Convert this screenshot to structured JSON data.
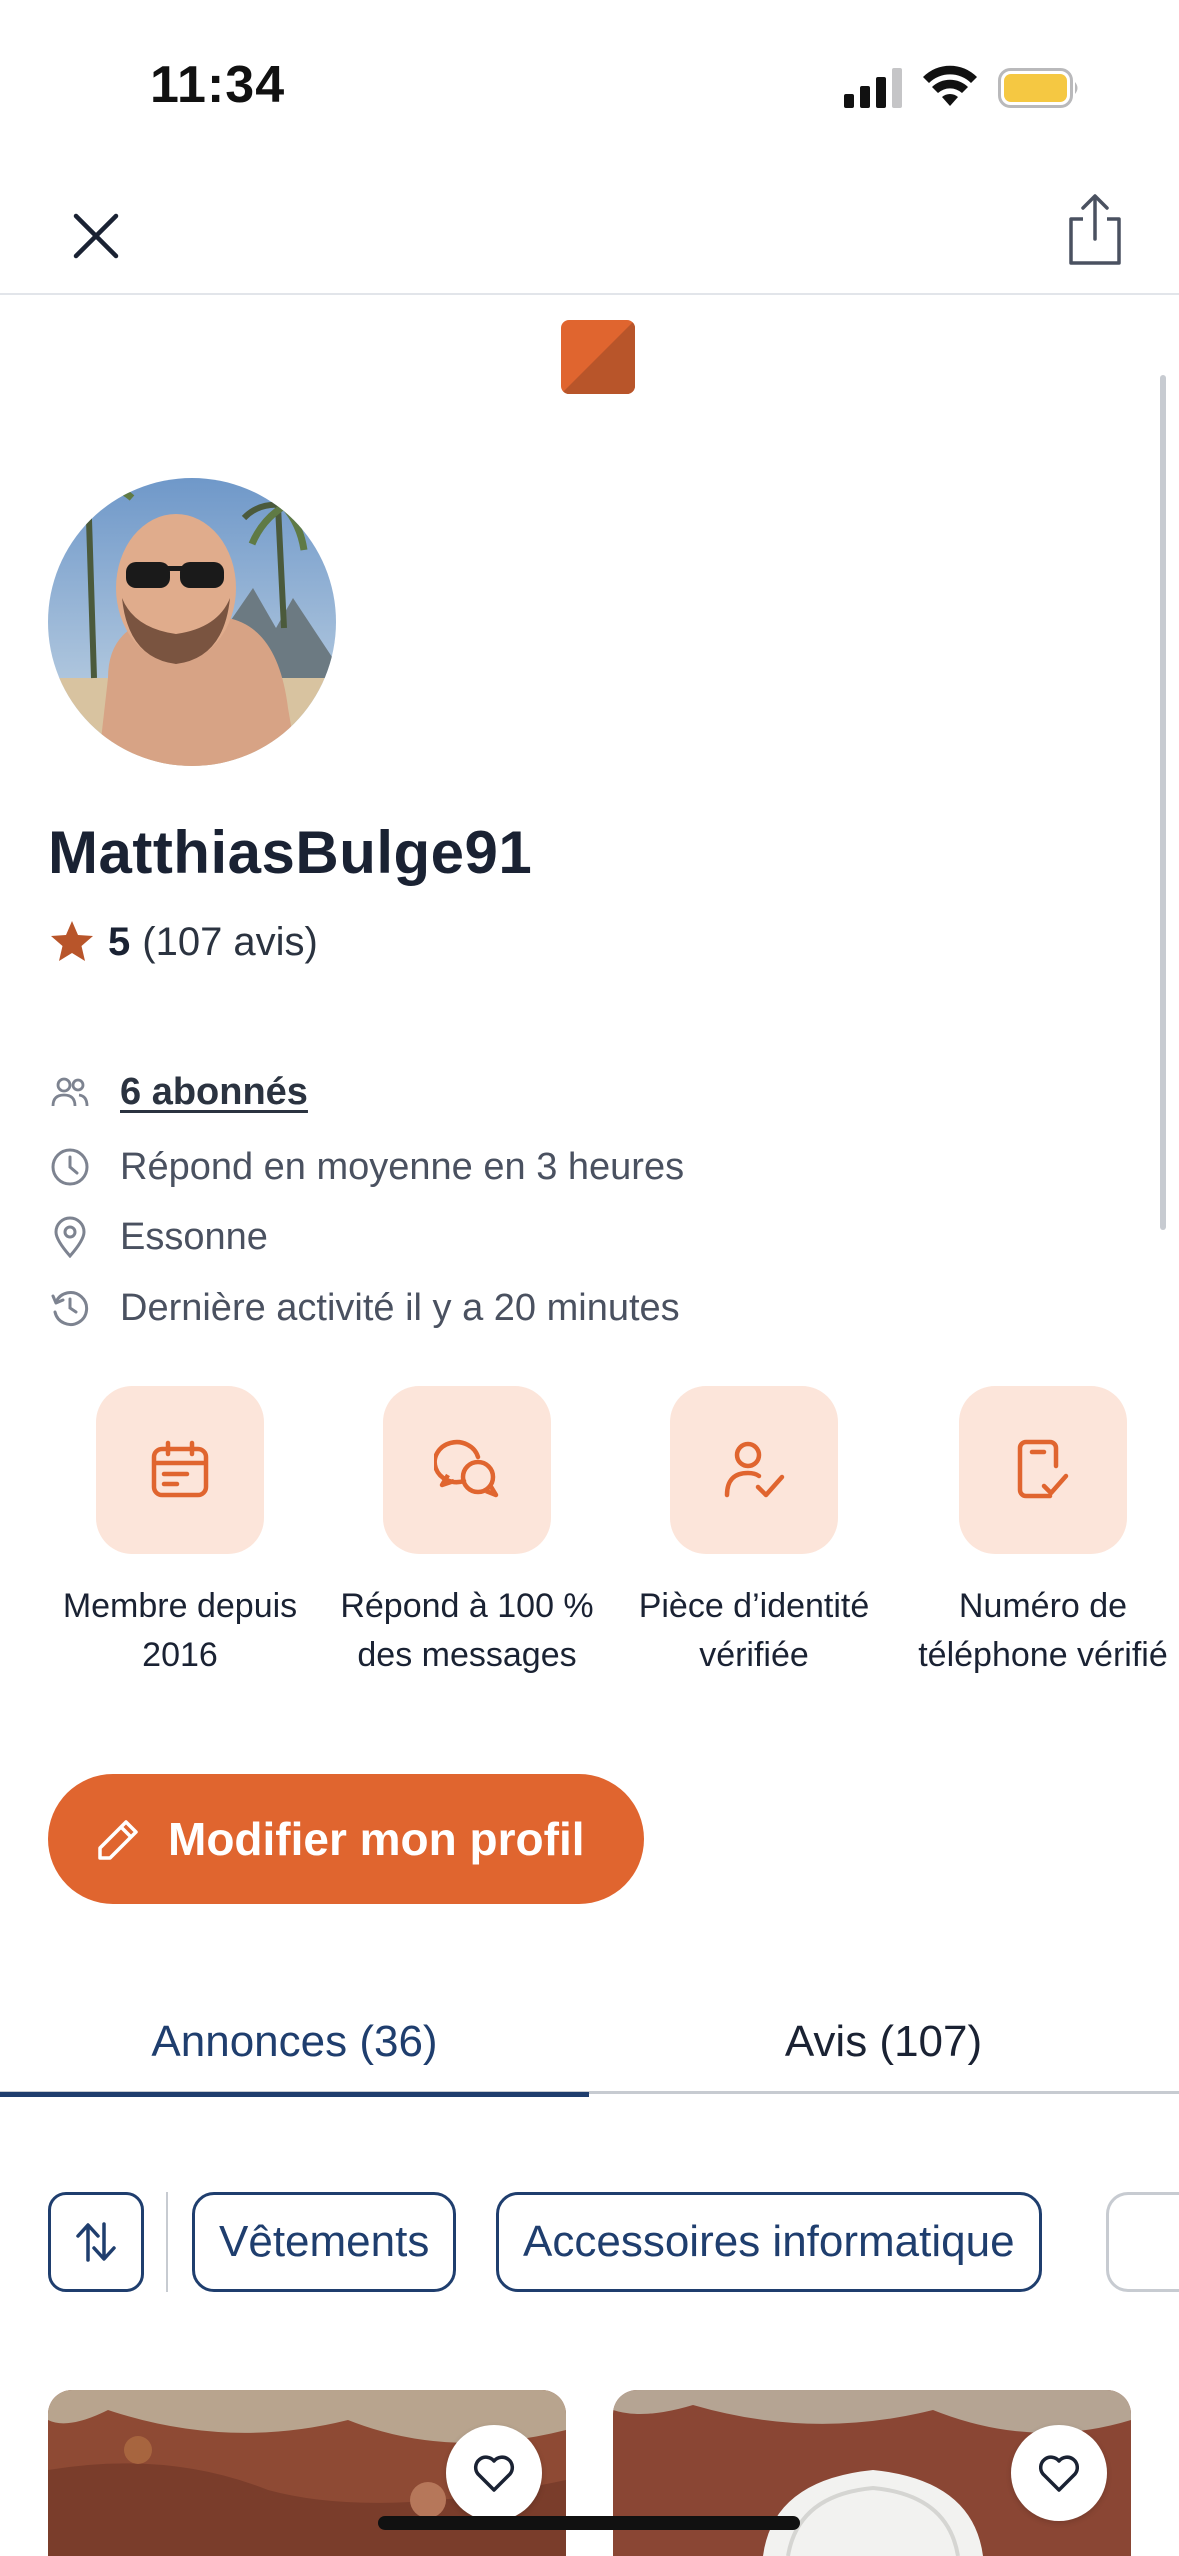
{
  "status_bar": {
    "time": "11:34",
    "battery_color": "#f5c842"
  },
  "profile": {
    "username": "MatthiasBulge91",
    "rating_score": "5",
    "rating_count": "(107 avis)",
    "followers": "6 abonnés",
    "response_time": "Répond en moyenne en 3 heures",
    "location": "Essonne",
    "last_activity": "Dernière activité il y a 20 minutes"
  },
  "badges": [
    {
      "icon": "calendar-icon",
      "label": "Membre depuis 2016"
    },
    {
      "icon": "chat-bubbles-icon",
      "label": "Répond à 100 % des messages"
    },
    {
      "icon": "user-check-icon",
      "label": "Pièce d’identité vérifiée"
    },
    {
      "icon": "phone-check-icon",
      "label": "Numéro de téléphone vérifié"
    }
  ],
  "actions": {
    "edit_profile": "Modifier mon profil"
  },
  "tabs": [
    {
      "label": "Annonces (36)",
      "active": true
    },
    {
      "label": "Avis (107)",
      "active": false
    }
  ],
  "filters": {
    "chips": [
      "Vêtements",
      "Accessoires informatique"
    ]
  },
  "colors": {
    "accent": "#e0652f",
    "navy": "#1f3e6e",
    "badge_bg": "#fce5da"
  }
}
